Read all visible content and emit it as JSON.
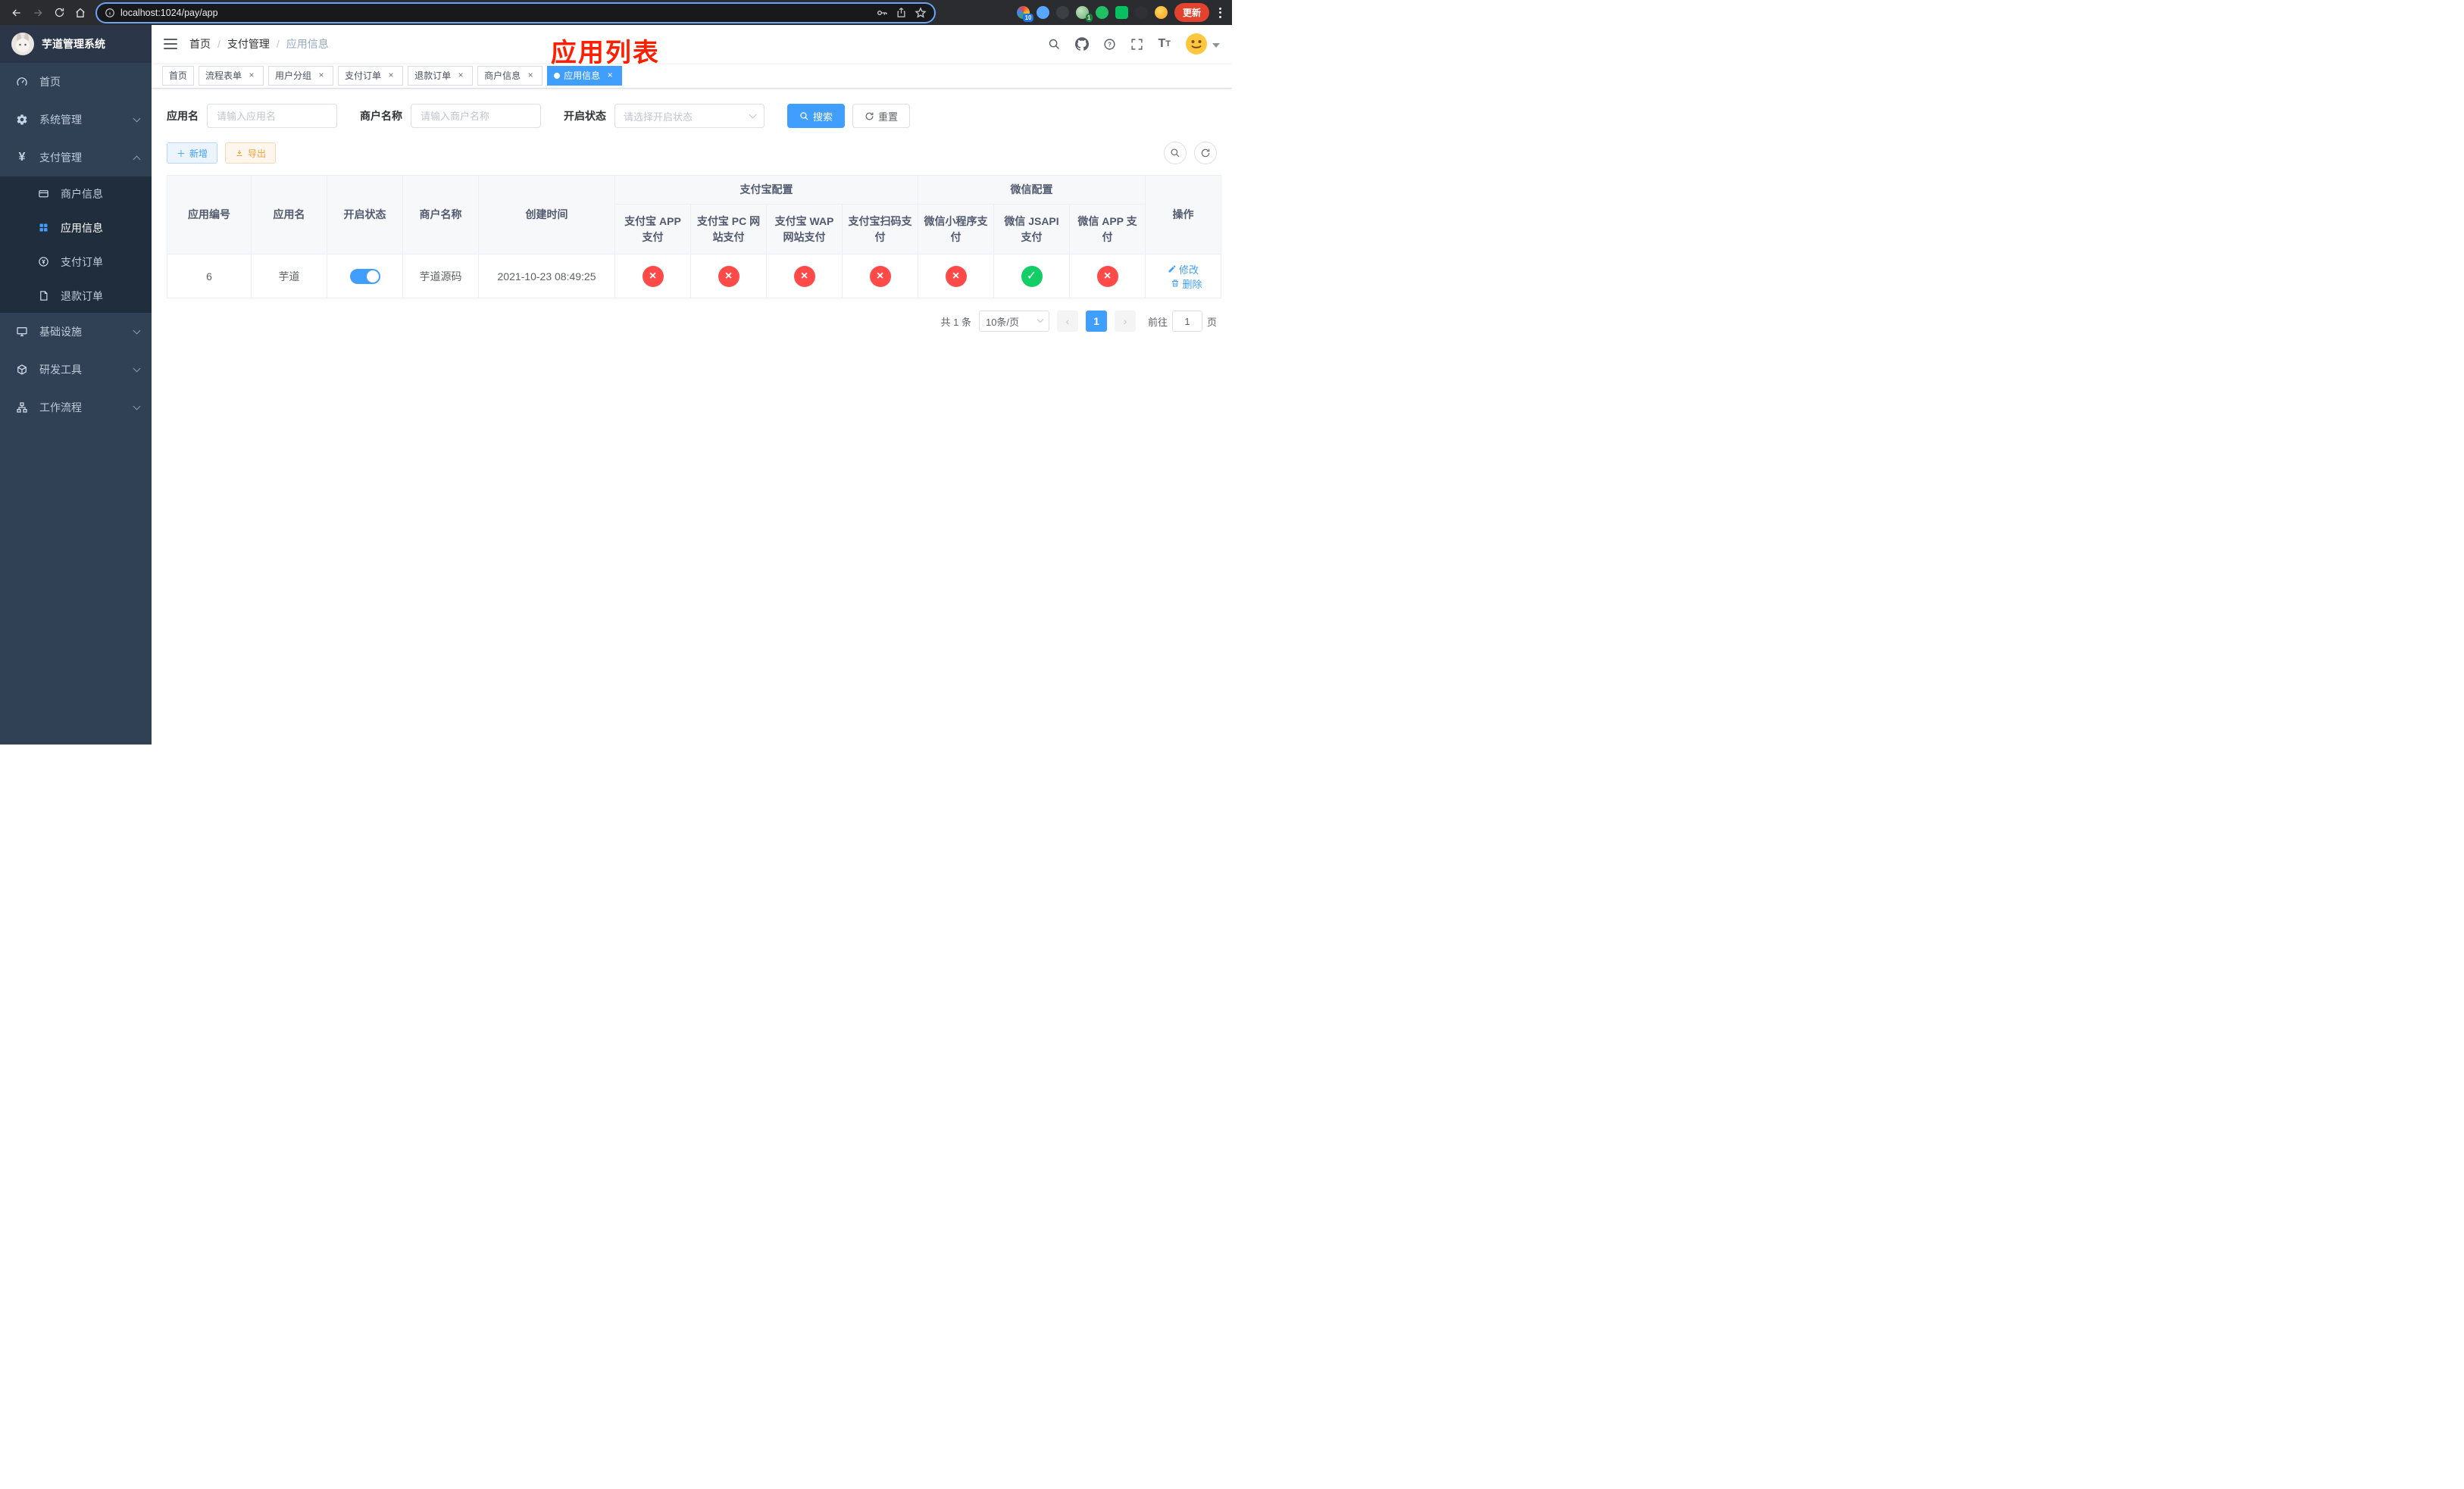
{
  "colors": {
    "accent": "#409eff",
    "success": "#13ce66",
    "danger": "#ff4a4a",
    "warning": "#e6a23c",
    "sidebar": "#304156",
    "submenu": "#1f2d3d",
    "chrome": "#2b2c2f",
    "update": "#e1432e",
    "annotation": "#ff1f00"
  },
  "browser": {
    "url": "localhost:1024/pay/app",
    "update_label": "更新",
    "extensions_badge": "10",
    "profile_badge": "1"
  },
  "sidebar": {
    "title": "芋道管理系统",
    "menu": [
      {
        "label": "首页"
      },
      {
        "label": "系统管理"
      },
      {
        "label": "支付管理"
      },
      {
        "label": "基础设施"
      },
      {
        "label": "研发工具"
      },
      {
        "label": "工作流程"
      }
    ],
    "submenu": [
      {
        "label": "商户信息"
      },
      {
        "label": "应用信息"
      },
      {
        "label": "支付订单"
      },
      {
        "label": "退款订单"
      }
    ]
  },
  "header": {
    "breadcrumb": [
      "首页",
      "支付管理",
      "应用信息"
    ],
    "separator": "/",
    "annotation": "应用列表"
  },
  "tabs": [
    {
      "label": "首页"
    },
    {
      "label": "流程表单"
    },
    {
      "label": "用户分组"
    },
    {
      "label": "支付订单"
    },
    {
      "label": "退款订单"
    },
    {
      "label": "商户信息"
    },
    {
      "label": "应用信息"
    }
  ],
  "filters": {
    "app_name_label": "应用名",
    "app_name_placeholder": "请输入应用名",
    "merchant_label": "商户名称",
    "merchant_placeholder": "请输入商户名称",
    "status_label": "开启状态",
    "status_placeholder": "请选择开启状态",
    "search_label": "搜索",
    "reset_label": "重置"
  },
  "toolbar": {
    "add_label": "新增",
    "export_label": "导出"
  },
  "table": {
    "simple_columns": [
      "应用编号",
      "应用名",
      "开启状态",
      "商户名称",
      "创建时间"
    ],
    "group_alipay": {
      "label": "支付宝配置",
      "children": [
        "支付宝 APP 支付",
        "支付宝 PC 网站支付",
        "支付宝 WAP 网站支付",
        "支付宝扫码支付"
      ]
    },
    "group_wechat": {
      "label": "微信配置",
      "children": [
        "微信小程序支付",
        "微信 JSAPI 支付",
        "微信 APP 支付"
      ]
    },
    "actions_column": "操作",
    "rows": [
      {
        "id": "6",
        "name": "芋道",
        "enabled": true,
        "merchant": "芋道源码",
        "created_at": "2021-10-23 08:49:25",
        "statuses": [
          false,
          false,
          false,
          false,
          false,
          true,
          false
        ],
        "edit_label": "修改",
        "delete_label": "删除"
      }
    ]
  },
  "pagination": {
    "total_text": "共 1 条",
    "page_size_text": "10条/页",
    "page": "1",
    "goto_label": "前往",
    "goto_value": "1",
    "page_unit": "页"
  }
}
